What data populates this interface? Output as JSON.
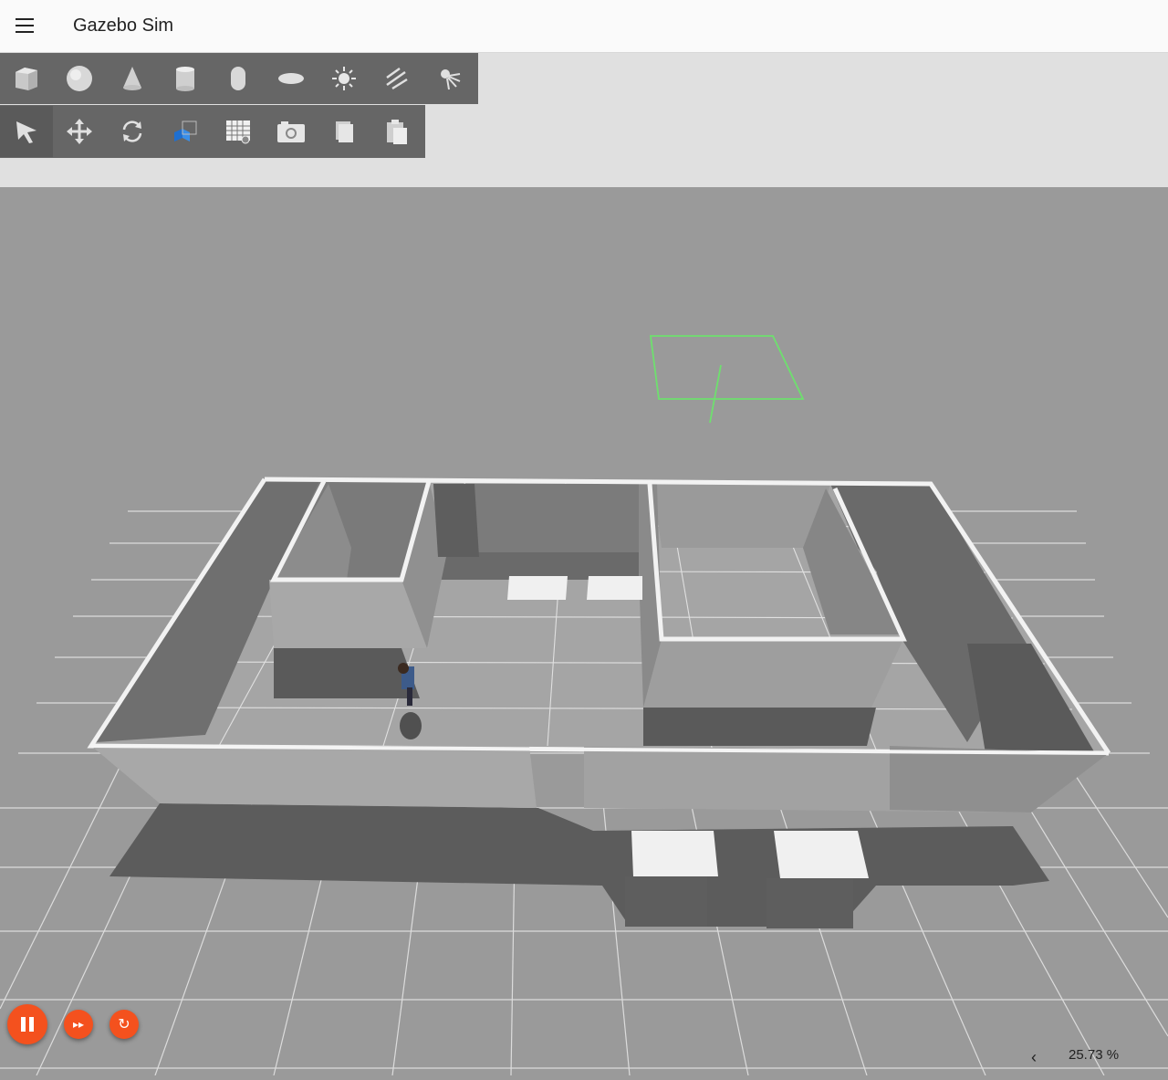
{
  "app": {
    "title": "Gazebo Sim"
  },
  "toolbar_shapes": [
    "box-icon",
    "sphere-icon",
    "cone-icon",
    "cylinder-icon",
    "capsule-icon",
    "ellipsoid-icon",
    "point-light-icon",
    "directional-light-icon",
    "spot-light-icon"
  ],
  "toolbar_transform": [
    "select-mode-icon",
    "translate-mode-icon",
    "rotate-mode-icon",
    "view-angle-icon",
    "grid-config-icon",
    "screenshot-icon",
    "copy-icon",
    "paste-icon"
  ],
  "selected_tool": "select-mode-icon",
  "playback": {
    "state": "running",
    "step_glyph": "▸▸",
    "reset_glyph": "↻"
  },
  "stats": {
    "collapse_glyph": "‹",
    "real_time_factor": "25.73 %"
  },
  "colors": {
    "accent": "#f4511e",
    "toolbar": "#666666",
    "ground": "#9a9a9a",
    "grid": "#e0e0e0",
    "walls": "#7d7d7d",
    "camera_frustum": "#6ee06e"
  }
}
